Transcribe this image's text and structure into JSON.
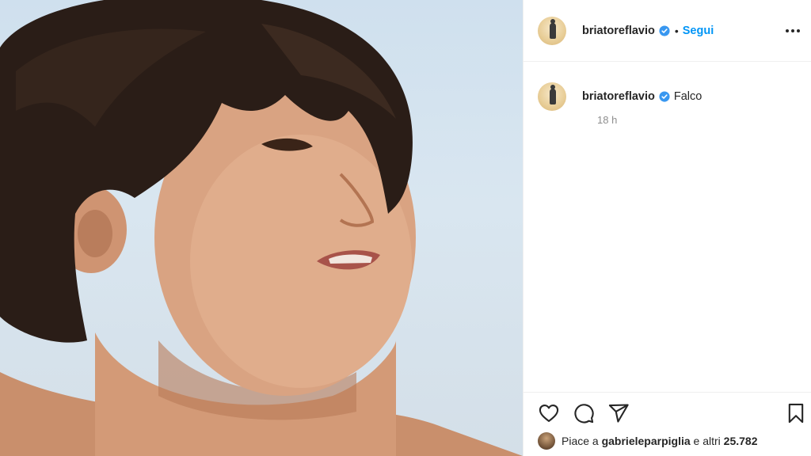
{
  "post": {
    "author": "briatoreflavio",
    "follow_label": "Segui",
    "separator": "•",
    "caption": "Falco",
    "time": "18 h",
    "likes": {
      "prefix": "Piace a",
      "user": "gabrieleparpiglia",
      "middle": "e altri",
      "count": "25.782"
    }
  },
  "icons": {
    "verified": "verified-badge-icon",
    "more": "more-options-icon",
    "like": "heart-icon",
    "comment": "comment-icon",
    "share": "share-icon",
    "save": "bookmark-icon"
  },
  "colors": {
    "accent": "#0095f6",
    "text": "#262626",
    "muted": "#8e8e8e",
    "divider": "#efefef"
  }
}
